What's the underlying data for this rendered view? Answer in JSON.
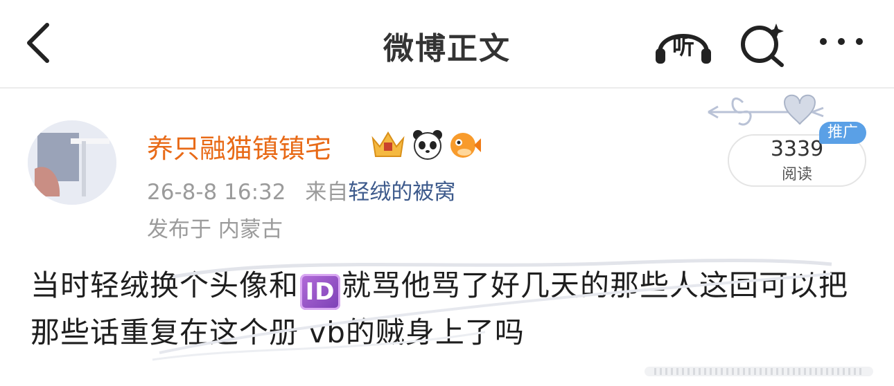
{
  "topbar": {
    "title": "微博正文",
    "back_icon": "chevron-left-icon",
    "listen_label": "听",
    "search_icon": "sparkle-search-icon",
    "more_icon": "more-dots-icon"
  },
  "post": {
    "username": "养只融猫镇镇宅",
    "badges": [
      "crown-badge-icon",
      "panda-emoji-icon",
      "pufferfish-emoji-icon"
    ],
    "time": "26-8-8 16:32",
    "source_prefix": "来自",
    "source": "轻绒的被窝",
    "location": "发布于 内蒙古",
    "read_count": "3339",
    "read_label": "阅读",
    "promo_label": "推广",
    "text_part1": "当时轻绒换个头像和",
    "emoji_id": "ID",
    "text_part2": "就骂他骂了好几天的那些人这回可以把那些话重复在这个册 vb的贼身上了吗"
  },
  "colors": {
    "username": "#e86a17",
    "source_link": "#3d5a8c",
    "meta_gray": "#9b9b9b",
    "promo_blue": "#5aa0e6"
  }
}
